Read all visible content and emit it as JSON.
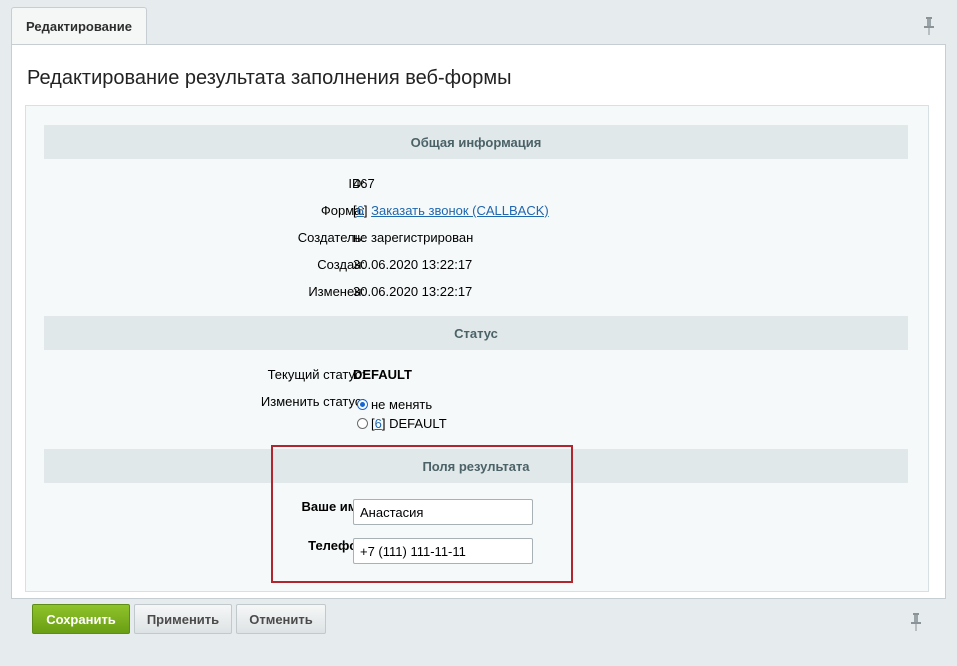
{
  "tab": {
    "label": "Редактирование"
  },
  "page": {
    "title": "Редактирование результата заполнения веб-формы"
  },
  "general": {
    "heading": "Общая информация",
    "id_label": "ID:",
    "id_value": "467",
    "form_label": "Форма:",
    "form_bracket_open": "[",
    "form_id": "6",
    "form_bracket_close": "]",
    "form_name": "Заказать звонок (CALLBACK)",
    "creator_label": "Создатель:",
    "creator_value": "не зарегистрирован",
    "created_label": "Создан:",
    "created_value": "30.06.2020 13:22:17",
    "modified_label": "Изменен:",
    "modified_value": "30.06.2020 13:22:17"
  },
  "status": {
    "heading": "Статус",
    "current_label": "Текущий статус:",
    "current_value": "DEFAULT",
    "change_label": "Изменить статус:",
    "options": [
      {
        "label": "не менять",
        "checked": true
      },
      {
        "prefix": "[",
        "id": "6",
        "suffix": "] DEFAULT",
        "checked": false
      }
    ]
  },
  "fields": {
    "heading": "Поля результата",
    "name_label": "Ваше имя",
    "name_value": "Анастасия",
    "phone_label": "Телефон",
    "phone_value": "+7 (111) 111-11-11"
  },
  "buttons": {
    "save": "Сохранить",
    "apply": "Применить",
    "cancel": "Отменить"
  },
  "colors": {
    "highlight": "#b0252e",
    "save_green": "#7cb11f",
    "link": "#2067b0"
  },
  "icons": {
    "pin": "pin-icon"
  }
}
